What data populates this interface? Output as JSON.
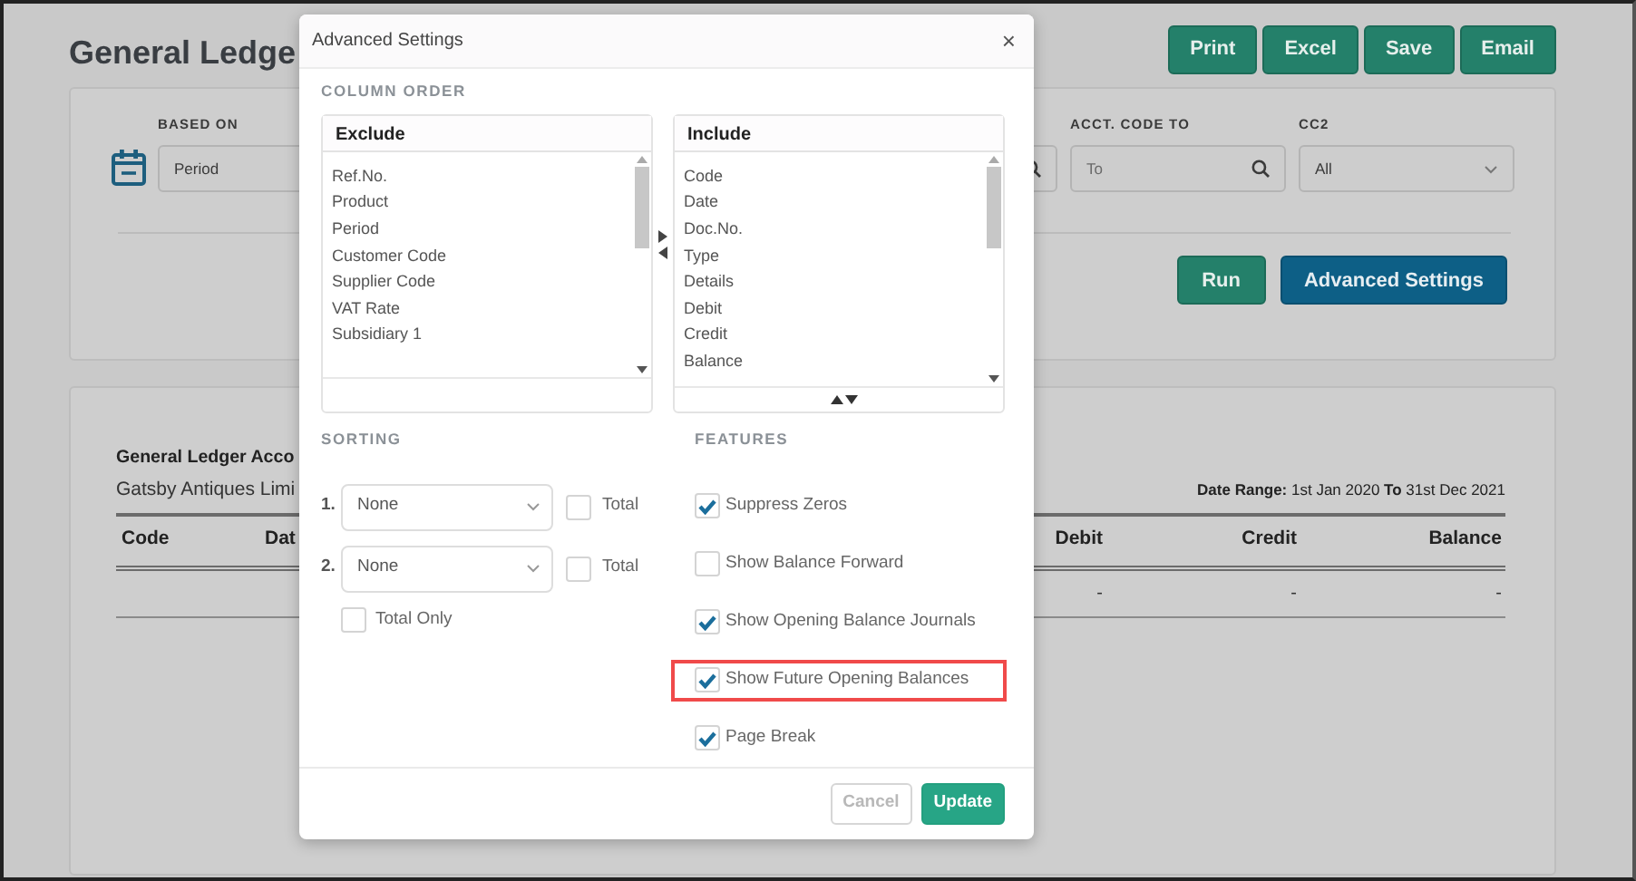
{
  "page": {
    "title": "General Ledge",
    "actions": [
      "Print",
      "Excel",
      "Save",
      "Email"
    ]
  },
  "filters": [
    {
      "kind": "select",
      "label": "BASED ON",
      "value": "Period"
    },
    {
      "kind": "search"
    },
    {
      "kind": "search",
      "label": "ACCT. CODE TO",
      "placeholder": "To"
    },
    {
      "kind": "select",
      "label": "CC2",
      "value": "All"
    }
  ],
  "run_buttons": [
    {
      "kind": "run",
      "label": "Run"
    },
    {
      "kind": "advanced",
      "label": "Advanced Settings"
    }
  ],
  "report": {
    "title": "General Ledger Acco",
    "company": "Gatsby Antiques Limi",
    "date_range": "**Date Range:** 1st Jan 2020 **To** 31st Dec 2021",
    "columns": [
      "Code",
      "Dat",
      "Debit",
      "Credit",
      "Balance"
    ],
    "rows": [
      [
        "",
        "",
        "-",
        "-",
        "-"
      ]
    ]
  },
  "modal": {
    "title": "Advanced Settings",
    "close": "×",
    "column_order": {
      "heading": "COLUMN ORDER",
      "exclude": {
        "heading": "Exclude",
        "items": [
          "Ref.No.",
          "Product",
          "Period",
          "Customer Code",
          "Supplier Code",
          "VAT Rate",
          "Subsidiary 1"
        ]
      },
      "include": {
        "heading": "Include",
        "items": [
          "Code",
          "Date",
          "Doc.No.",
          "Type",
          "Details",
          "Debit",
          "Credit",
          "Balance"
        ]
      }
    },
    "sorting": {
      "heading": "SORTING",
      "rows": [
        {
          "number": "1.",
          "value": "None",
          "total_label": "Total",
          "total_checked": false
        },
        {
          "number": "2.",
          "value": "None",
          "total_label": "Total",
          "total_checked": false
        }
      ],
      "total_only": {
        "label": "Total Only",
        "checked": false
      }
    },
    "features": {
      "heading": "FEATURES",
      "items": [
        {
          "label": "Suppress Zeros",
          "checked": true,
          "highlighted": false
        },
        {
          "label": "Show Balance Forward",
          "checked": false,
          "highlighted": false
        },
        {
          "label": "Show Opening Balance Journals",
          "checked": true,
          "highlighted": false
        },
        {
          "label": "Show Future Opening Balances",
          "checked": true,
          "highlighted": true
        },
        {
          "label": "Page Break",
          "checked": true,
          "highlighted": false
        }
      ]
    },
    "footer": [
      {
        "kind": "cancel",
        "label": "Cancel"
      },
      {
        "kind": "primary",
        "label": "Update"
      }
    ]
  }
}
